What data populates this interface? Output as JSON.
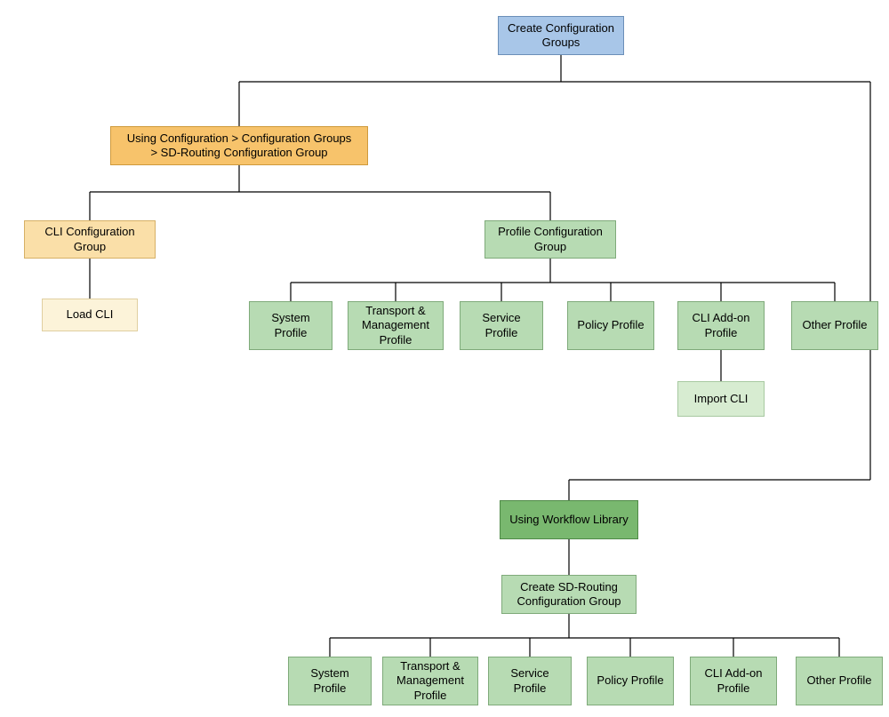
{
  "root": {
    "label": "Create Configuration\nGroups"
  },
  "path": {
    "label": "Using Configuration > Configuration Groups\n> SD-Routing Configuration Group"
  },
  "cli_group": {
    "label": "CLI  Configuration\nGroup"
  },
  "load_cli": {
    "label": "Load CLI"
  },
  "profile_group": {
    "label": "Profile Configuration\nGroup"
  },
  "profiles1": {
    "system": {
      "label": "System\nProfile"
    },
    "transport": {
      "label": "Transport &\nManagement\nProfile"
    },
    "service": {
      "label": "Service\nProfile"
    },
    "policy": {
      "label": "Policy Profile"
    },
    "cli_addon": {
      "label": "CLI Add-on\nProfile"
    },
    "other": {
      "label": "Other Profile"
    }
  },
  "import_cli": {
    "label": "Import CLI"
  },
  "workflow": {
    "label": "Using Workflow Library"
  },
  "create_sdr": {
    "label": "Create SD-Routing\nConfiguration Group"
  },
  "profiles2": {
    "system": {
      "label": "System\nProfile"
    },
    "transport": {
      "label": "Transport &\nManagement\nProfile"
    },
    "service": {
      "label": "Service\nProfile"
    },
    "policy": {
      "label": "Policy Profile"
    },
    "cli_addon": {
      "label": "CLI Add-on\nProfile"
    },
    "other": {
      "label": "Other Profile"
    }
  }
}
